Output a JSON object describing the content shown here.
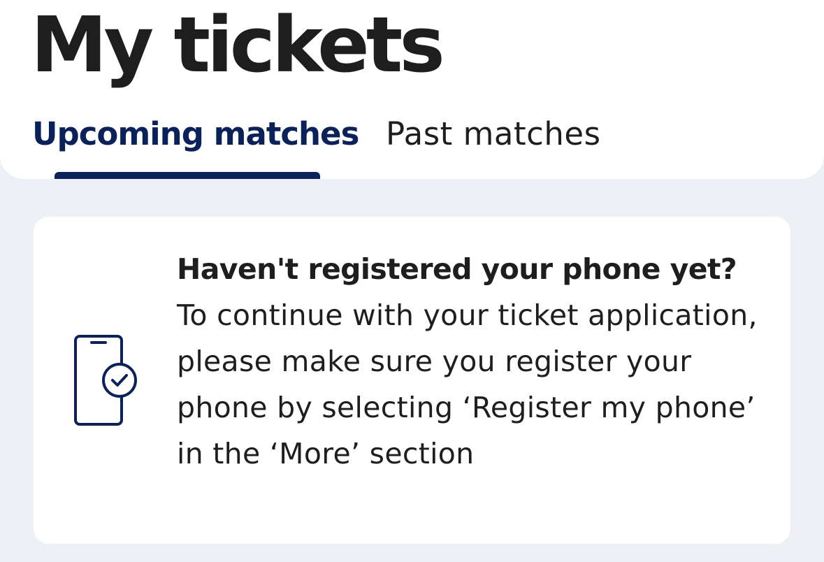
{
  "header": {
    "title": "My tickets",
    "tabs": [
      {
        "label": "Upcoming matches",
        "selected": true
      },
      {
        "label": "Past matches",
        "selected": false
      }
    ]
  },
  "notice": {
    "icon": "phone-check-icon",
    "title": "Haven't registered your phone yet?",
    "body": "To continue with your ticket application, please make sure you register your phone by selecting ‘Register my phone’ in the ‘More’ section"
  },
  "colors": {
    "accent": "#0A2259",
    "text": "#1E1E1E",
    "background": "#EDF0F4",
    "surface": "#FFFFFF"
  }
}
